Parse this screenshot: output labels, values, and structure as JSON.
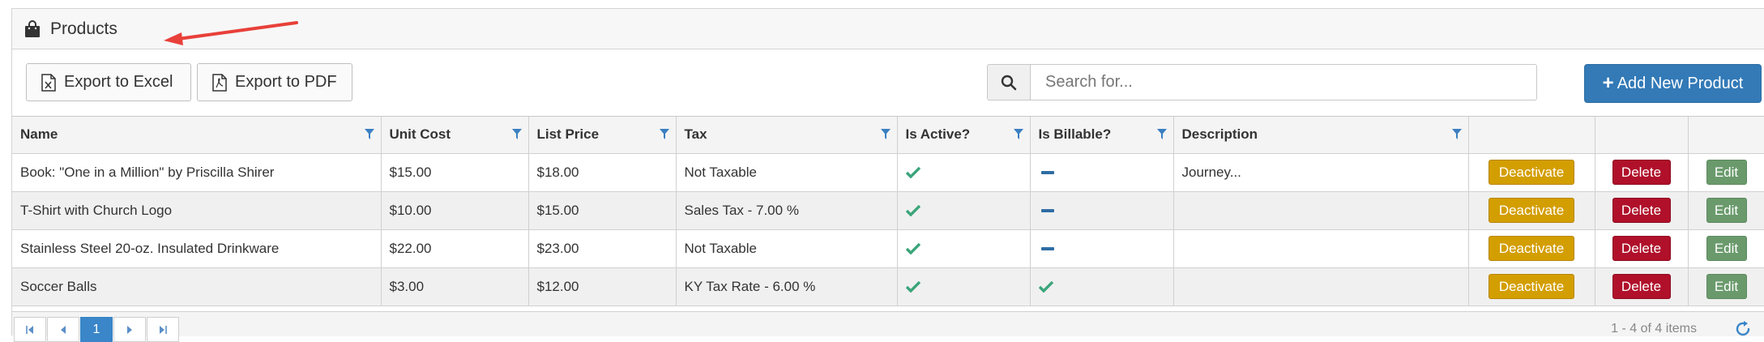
{
  "panel": {
    "title": "Products",
    "icon": "shopping-bag-icon"
  },
  "toolbar": {
    "export_excel_label": "Export to Excel",
    "export_pdf_label": "Export to PDF",
    "search_placeholder": "Search for...",
    "search_value": "",
    "add_label": "Add New Product"
  },
  "table": {
    "columns": [
      {
        "label": "Name",
        "filter": true
      },
      {
        "label": "Unit Cost",
        "filter": true
      },
      {
        "label": "List Price",
        "filter": true
      },
      {
        "label": "Tax",
        "filter": true
      },
      {
        "label": "Is Active?",
        "filter": true
      },
      {
        "label": "Is Billable?",
        "filter": true
      },
      {
        "label": "Description",
        "filter": true
      }
    ],
    "rows": [
      {
        "name": "Book: \"One in a Million\" by Priscilla Shirer",
        "unit_cost": "$15.00",
        "list_price": "$18.00",
        "tax": "Not Taxable",
        "is_active": true,
        "is_billable": false,
        "description": "Journey..."
      },
      {
        "name": "T-Shirt with Church Logo",
        "unit_cost": "$10.00",
        "list_price": "$15.00",
        "tax": "Sales Tax - 7.00 %",
        "is_active": true,
        "is_billable": false,
        "description": ""
      },
      {
        "name": "Stainless Steel 20-oz. Insulated Drinkware",
        "unit_cost": "$22.00",
        "list_price": "$23.00",
        "tax": "Not Taxable",
        "is_active": true,
        "is_billable": false,
        "description": ""
      },
      {
        "name": "Soccer Balls",
        "unit_cost": "$3.00",
        "list_price": "$12.00",
        "tax": "KY Tax Rate - 6.00 %",
        "is_active": true,
        "is_billable": true,
        "description": ""
      }
    ],
    "row_actions": {
      "deactivate": "Deactivate",
      "delete": "Delete",
      "edit": "Edit"
    }
  },
  "pager": {
    "current_page": "1",
    "info": "1 - 4 of 4 items"
  },
  "colors": {
    "primary": "#337ab7",
    "warning": "#d39e00",
    "danger": "#b0102a",
    "success": "#6a9a6c",
    "check": "#3aa57a",
    "annotation_arrow": "#e8403a"
  }
}
